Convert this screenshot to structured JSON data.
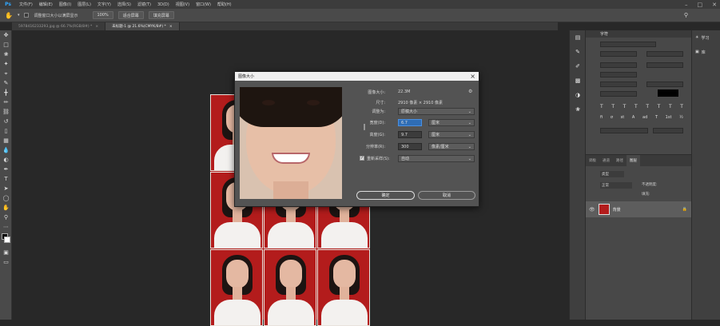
{
  "app": {
    "logo": "Ps"
  },
  "menu": [
    "文件(F)",
    "编辑(E)",
    "图像(I)",
    "图层(L)",
    "文字(Y)",
    "选择(S)",
    "滤镜(T)",
    "3D(D)",
    "视图(V)",
    "窗口(W)",
    "帮助(H)"
  ],
  "options": {
    "checkbox_label": "调整窗口大小以满屏显示",
    "zoom": "100%",
    "fit_label": "适合屏幕",
    "fill_label": "填充屏幕"
  },
  "tabs": [
    {
      "label": "5978416233293.jpg @ 66.7%(RGB/8#) *"
    },
    {
      "label": "未标题-1 @ 21.6%(CMYK/8#) *"
    }
  ],
  "dialog": {
    "title": "图像大小",
    "image_size_label": "图像大小:",
    "image_size_value": "22.3M",
    "dimensions_label": "尺寸:",
    "dimensions_value": "2910 像素 × 2910 像素",
    "fit_to_label": "调整为:",
    "fit_to_value": "原稿大小",
    "width_label": "宽度(D):",
    "width_value": "6.7",
    "width_unit": "厘米",
    "height_label": "高度(G):",
    "height_value": "9.7",
    "height_unit": "厘米",
    "resolution_label": "分辨率(R):",
    "resolution_value": "300",
    "resolution_unit": "像素/厘米",
    "resample_label": "重新采样(S):",
    "resample_value": "自动",
    "ok_label": "确定",
    "cancel_label": "取消"
  },
  "panels": {
    "character_title": "字符",
    "layer_tabs": [
      "调板",
      "通道",
      "路径",
      "图层"
    ],
    "layer_kind": "类型",
    "layer_mode": "正常",
    "layer_opacity_label": "不透明度:",
    "layer_fill_label": "填充:",
    "layer_name": "背景"
  },
  "far_right": {
    "learn_label": "学习",
    "libraries_label": "库"
  },
  "colors": {
    "accent": "#31a8ff",
    "background_red": "#b31c1c"
  }
}
